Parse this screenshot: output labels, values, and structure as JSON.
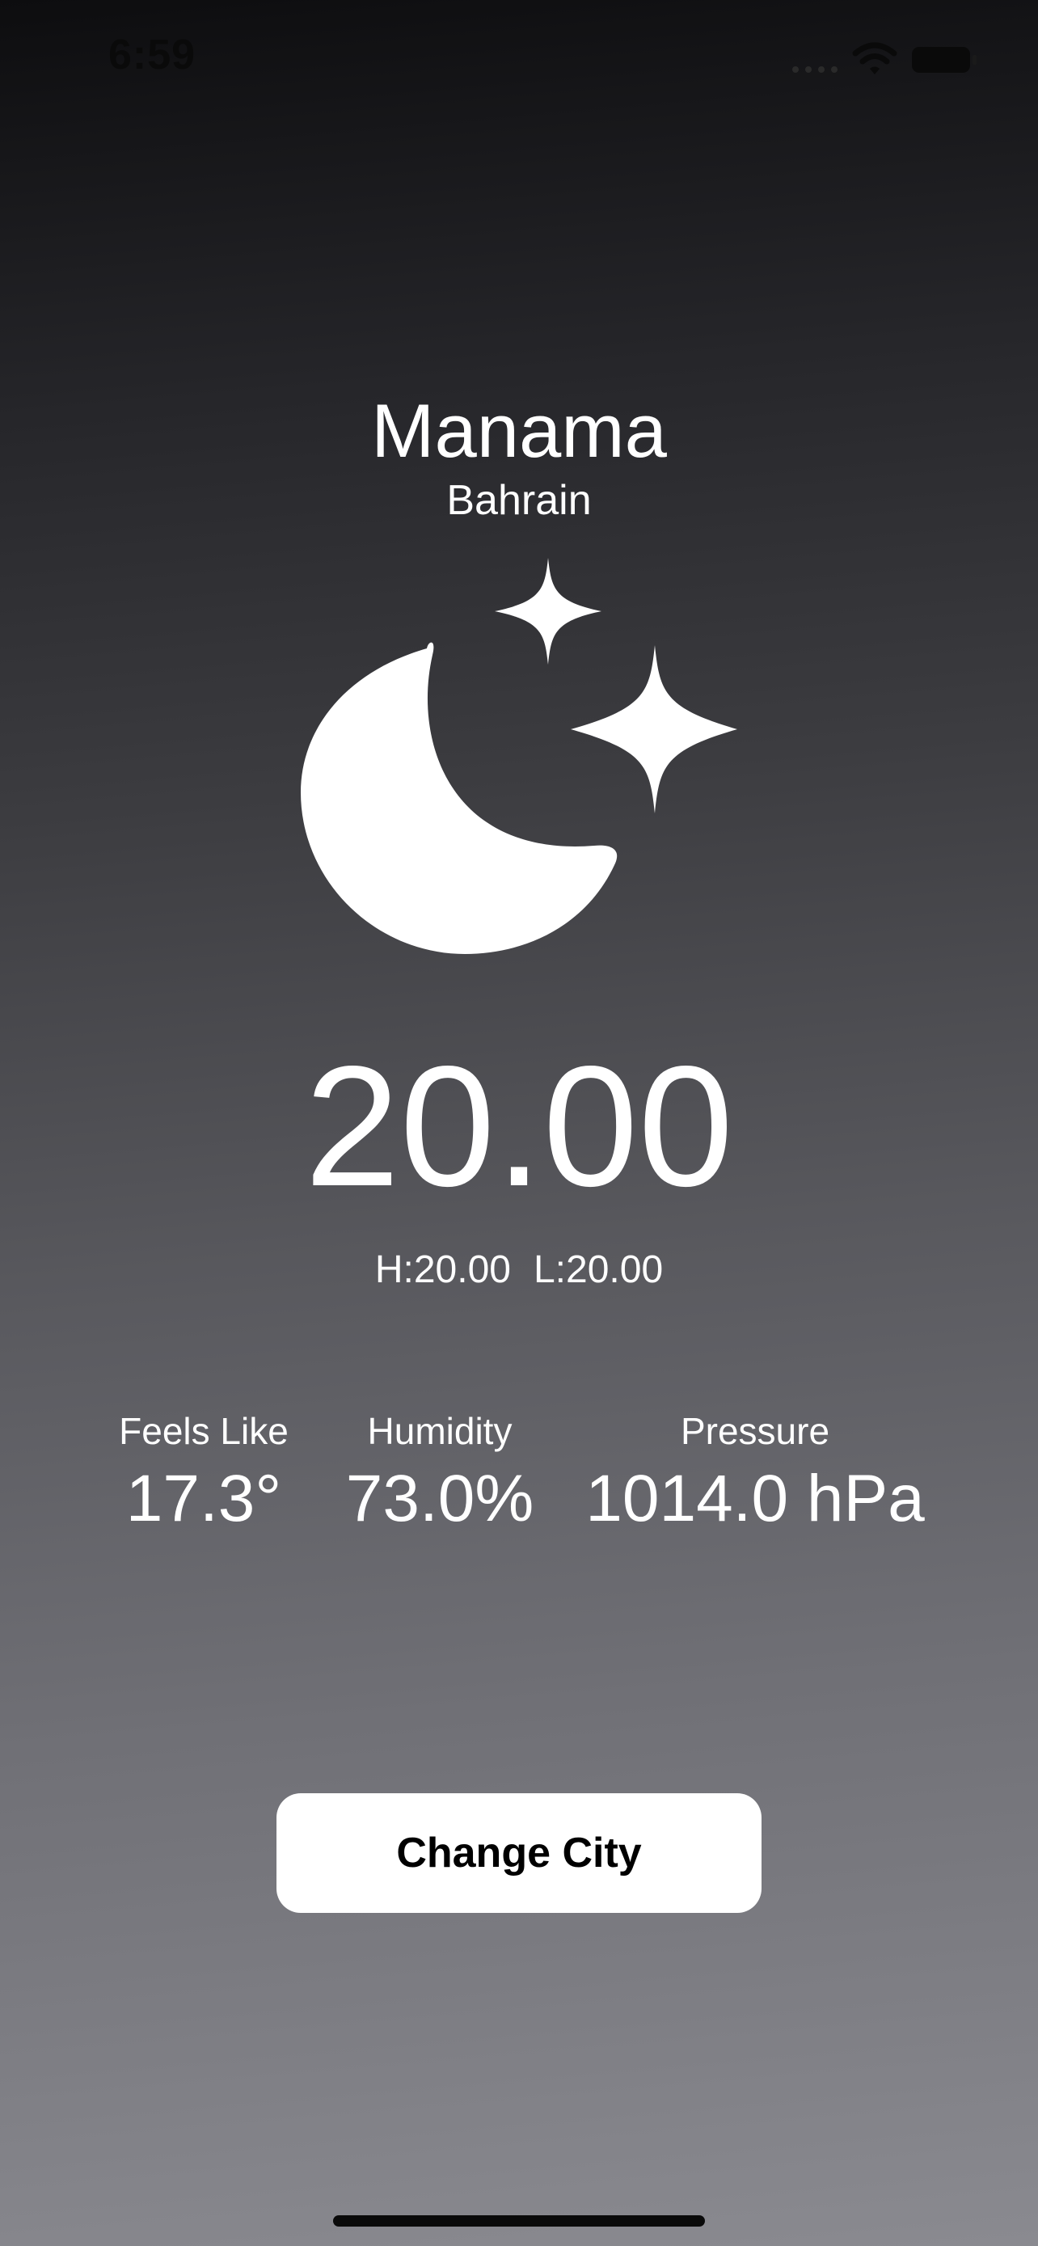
{
  "status_bar": {
    "time": "6:59",
    "icons": [
      "signal-icon",
      "wifi-icon",
      "battery-icon"
    ]
  },
  "location": {
    "city": "Manama",
    "country": "Bahrain"
  },
  "weather": {
    "icon": "moon-stars-icon",
    "temperature": "20.00",
    "high": "H:20.00",
    "low": "L:20.00"
  },
  "stats": {
    "feels_like_label": "Feels Like",
    "feels_like_value": "17.3°",
    "humidity_label": "Humidity",
    "humidity_value": "73.0%",
    "pressure_label": "Pressure",
    "pressure_value": "1014.0 hPa"
  },
  "actions": {
    "change_city_label": "Change City"
  },
  "colors": {
    "background_top": "#0d0d0f",
    "background_bottom": "#8a8a90",
    "text": "#ffffff",
    "button_bg": "#ffffff",
    "button_text": "#000000"
  }
}
